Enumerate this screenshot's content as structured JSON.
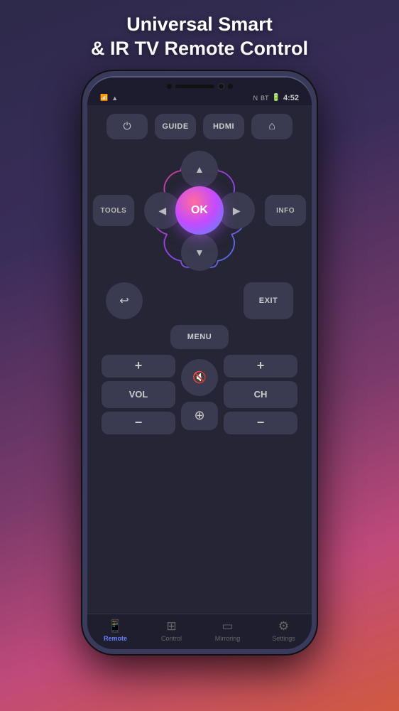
{
  "headline": {
    "line1": "Universal Smart",
    "line2": "& IR TV Remote Control"
  },
  "phone": {
    "status": {
      "time": "4:52",
      "wifi_icon": "wifi",
      "battery_icon": "battery",
      "nfc_icon": "N",
      "bt_icon": "BT"
    }
  },
  "remote": {
    "top_buttons": [
      {
        "label": "⏻",
        "type": "power"
      },
      {
        "label": "GUIDE",
        "type": "guide"
      },
      {
        "label": "HDMI",
        "type": "hdmi"
      },
      {
        "label": "⌂",
        "type": "home"
      }
    ],
    "side_left": "TOOLS",
    "side_right": "INFO",
    "dpad": {
      "up": "▲",
      "down": "▼",
      "left": "◀",
      "right": "▶",
      "ok": "OK"
    },
    "back_label": "↩",
    "exit_label": "EXIT",
    "menu_label": "MENU",
    "vol_plus": "+",
    "vol_label": "VOL",
    "vol_minus": "−",
    "ch_plus": "+",
    "ch_label": "CH",
    "ch_minus": "−",
    "mute_icon": "🔇",
    "source_icon": "⊕"
  },
  "bottom_nav": [
    {
      "icon": "📱",
      "label": "Remote",
      "active": true
    },
    {
      "icon": "⊞",
      "label": "Control",
      "active": false
    },
    {
      "icon": "▭",
      "label": "Mirroring",
      "active": false
    },
    {
      "icon": "⚙",
      "label": "Settings",
      "active": false
    }
  ],
  "colors": {
    "accent": "#6a7fff",
    "bg_dark": "#252535",
    "btn_bg": "#3a3a50"
  }
}
